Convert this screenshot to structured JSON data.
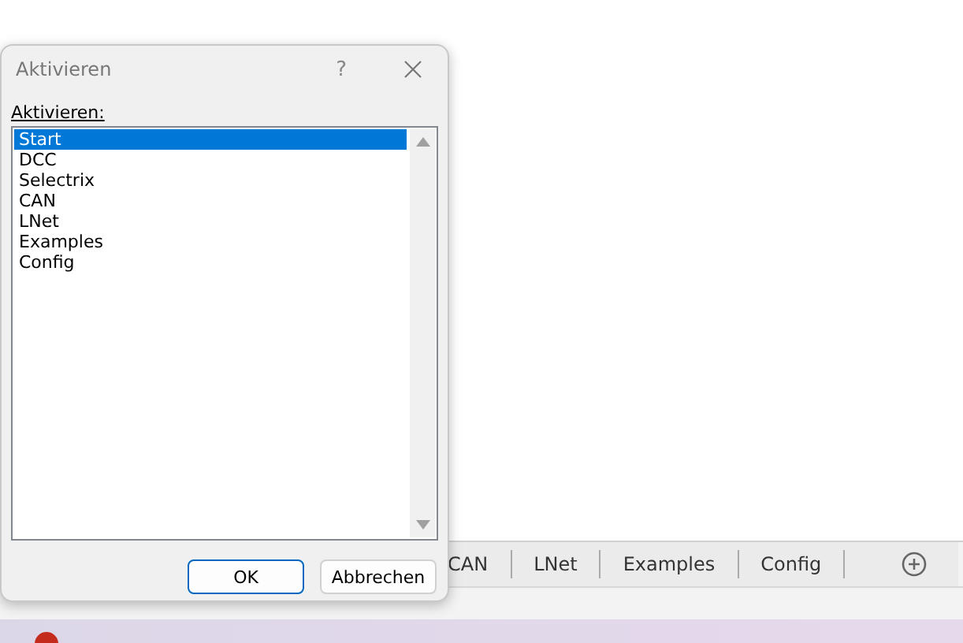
{
  "dialog": {
    "title": "Aktivieren",
    "help": "?",
    "label": "Aktivieren:",
    "items": [
      {
        "label": "Start",
        "selected": true
      },
      {
        "label": "DCC",
        "selected": false
      },
      {
        "label": "Selectrix",
        "selected": false
      },
      {
        "label": "CAN",
        "selected": false
      },
      {
        "label": "LNet",
        "selected": false
      },
      {
        "label": "Examples",
        "selected": false
      },
      {
        "label": "Config",
        "selected": false
      }
    ],
    "buttons": [
      {
        "label": "OK",
        "default": true
      },
      {
        "label": "Abbrechen",
        "default": false
      }
    ]
  },
  "sheet_tabs": [
    {
      "label": "CAN"
    },
    {
      "label": "LNet"
    },
    {
      "label": "Examples"
    },
    {
      "label": "Config"
    }
  ]
}
